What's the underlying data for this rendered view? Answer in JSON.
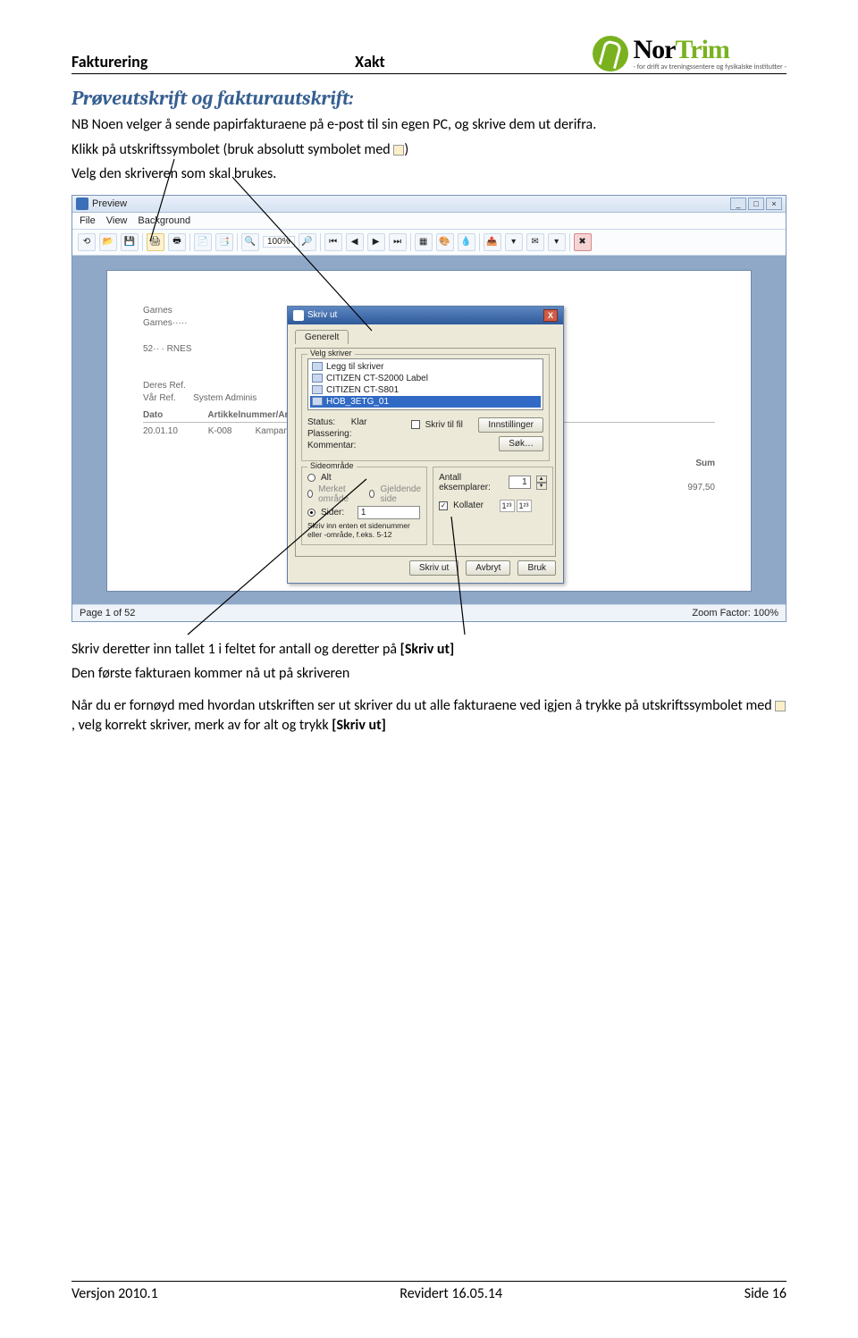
{
  "header": {
    "left": "Fakturering",
    "center": "Xakt"
  },
  "logo": {
    "brand_black": "Nor",
    "brand_green": "Trim",
    "tagline": "- for drift av treningssentere og fysikalske institutter -"
  },
  "doc": {
    "title": "Prøveutskrift  og fakturautskrift:",
    "p1": "NB Noen velger å sende papirfakturaene på e-post til sin egen PC, og skrive dem ut derifra.",
    "p2a": "Klikk på utskriftssymbolet (bruk absolutt symbolet med ",
    "p2b": ")",
    "p3": "Velg den skriveren som skal brukes.",
    "p4a": "Skriv deretter inn tallet 1 i feltet for antall og deretter på ",
    "p4b": "[Skriv ut]",
    "p5": "Den første fakturaen kommer nå ut på skriveren",
    "p6a": "Når du er fornøyd med hvordan utskriften ser ut skriver du ut alle fakturaene ved igjen å trykke på utskriftssymbolet med ",
    "p6b": ", velg korrekt skriver, merk av for alt og trykk ",
    "p6c": "[Skriv ut]"
  },
  "preview": {
    "title": "Preview",
    "menu": {
      "file": "File",
      "view": "View",
      "background": "Background"
    },
    "zoom": "100%",
    "status_left": "Page 1 of 52",
    "status_right": "Zoom Factor: 100%",
    "docpage": {
      "name1": "Garnes",
      "name2": "Garnes·····",
      "post": "52··  · RNES",
      "ref1": "Deres Ref.",
      "ref2": "Vår Ref.",
      "ref2v": "System Adminis",
      "th_dato": "Dato",
      "th_art": "Artikkelnummer/Artikk",
      "td_dato": "20.01.10",
      "td_k": "K-008",
      "td_kamp": "Kampanje",
      "sum_lbl": "Sum",
      "sum_val": "997,50"
    }
  },
  "dialog": {
    "title": "Skriv ut",
    "tab": "Generelt",
    "grp_printer": "Velg skriver",
    "printers": [
      "Legg til skriver",
      "CITIZEN CT-S2000 Label",
      "CITIZEN CT-S801",
      "HOB_3ETG_01"
    ],
    "status_lbl": "Status:",
    "status_val": "Klar",
    "loc_lbl": "Plassering:",
    "comment_lbl": "Kommentar:",
    "print_to_file": "Skriv til fil",
    "btn_settings": "Innstillinger",
    "btn_find": "Søk…",
    "grp_range": "Sideområde",
    "r_all": "Alt",
    "r_marked": "Merket område",
    "r_current": "Gjeldende side",
    "r_pages": "Sider:",
    "pages_val": "1",
    "pages_hint": "Skriv inn enten et sidenummer eller -område, f.eks. 5-12",
    "copies_lbl": "Antall eksemplarer:",
    "copies_val": "1",
    "collate": "Kollater",
    "btn_print": "Skriv ut",
    "btn_cancel": "Avbryt",
    "btn_apply": "Bruk"
  },
  "footer": {
    "left": "Versjon 2010.1",
    "center": "Revidert 16.05.14",
    "right": "Side 16"
  }
}
